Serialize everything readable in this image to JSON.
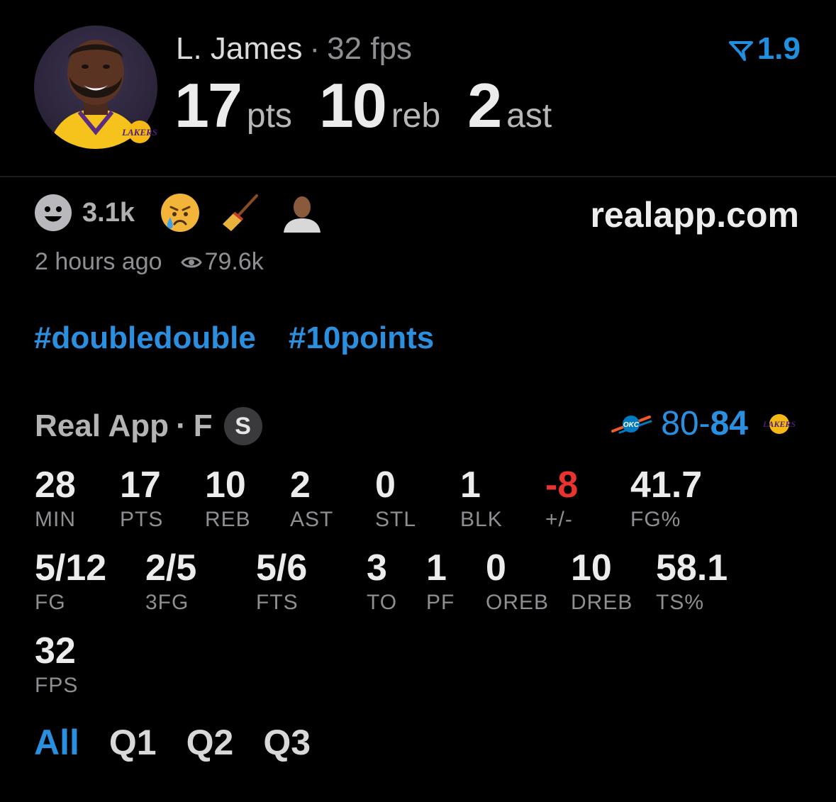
{
  "player": {
    "name": "L. James",
    "fps_label": "32 fps",
    "headline": [
      {
        "value": "17",
        "unit": "pts"
      },
      {
        "value": "10",
        "unit": "reb"
      },
      {
        "value": "2",
        "unit": "ast"
      }
    ],
    "multiplier": "1.9"
  },
  "reactions": {
    "count": "3.1k",
    "site": "realapp.com",
    "time_ago": "2 hours ago",
    "views": "79.6k"
  },
  "hashtags": [
    "#doubledouble",
    "#10points"
  ],
  "game": {
    "source": "Real App",
    "status": "F",
    "badge": "S",
    "away_score": "80",
    "home_score": "84",
    "away_logo_text": "OKC",
    "home_logo_text": "LAKERS"
  },
  "stats_row1": [
    {
      "value": "28",
      "label": "MIN"
    },
    {
      "value": "17",
      "label": "PTS"
    },
    {
      "value": "10",
      "label": "REB"
    },
    {
      "value": "2",
      "label": "AST"
    },
    {
      "value": "0",
      "label": "STL"
    },
    {
      "value": "1",
      "label": "BLK"
    },
    {
      "value": "-8",
      "label": "+/-"
    },
    {
      "value": "41.7",
      "label": "FG%"
    }
  ],
  "stats_row2": [
    {
      "value": "5/12",
      "label": "FG"
    },
    {
      "value": "2/5",
      "label": "3FG"
    },
    {
      "value": "5/6",
      "label": "FTS"
    },
    {
      "value": "3",
      "label": "TO"
    },
    {
      "value": "1",
      "label": "PF"
    },
    {
      "value": "0",
      "label": "OREB"
    },
    {
      "value": "10",
      "label": "DREB"
    },
    {
      "value": "58.1",
      "label": "TS%"
    }
  ],
  "stats_row3": [
    {
      "value": "32",
      "label": "FPS"
    }
  ],
  "tabs": [
    "All",
    "Q1",
    "Q2",
    "Q3"
  ],
  "colors": {
    "accent": "#2b8fe0",
    "negative": "#e8332f",
    "muted": "#8e8e93"
  }
}
